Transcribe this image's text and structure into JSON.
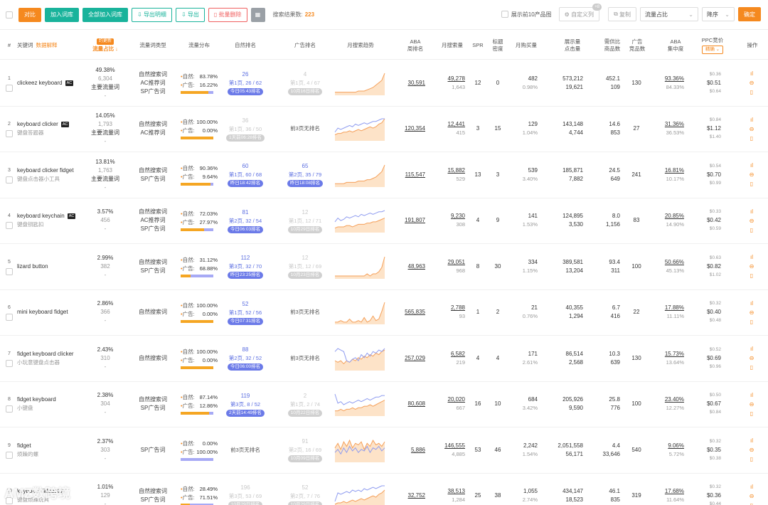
{
  "toolbar": {
    "compare": "对比",
    "add_to_lib": "加入词库",
    "add_all_to_lib": "全部加入词库",
    "export_detail": "导出明细",
    "export": "导出",
    "batch_delete": "批量删除",
    "result_label": "搜索结果数:",
    "result_count": "223",
    "show_top10": "展示前10产品图",
    "custom_columns": "自定义列",
    "custom_columns_badge": "+8",
    "copy": "复制",
    "sort_field": "流量占比",
    "sort_order": "降序",
    "confirm": "确定"
  },
  "header": {
    "idx": "#",
    "keyword": "关键词",
    "keyword_link": "数据解释",
    "share_tag": "约更新",
    "share": "流量占比",
    "type": "流量词类型",
    "flow": "流量分布",
    "natural": "自然排名",
    "ad": "广告排名",
    "trend": "月搜索趋势",
    "aba_1": "ABA",
    "aba_2": "周排名",
    "msv": "月搜索量",
    "spr": "SPR",
    "title_density_1": "标题",
    "title_density_2": "密度",
    "buy_1": "月购买量",
    "disp_1": "展示量",
    "disp_2": "点击量",
    "ratio_1": "需供比",
    "ratio_2": "商品数",
    "adprod_1": "广告",
    "adprod_2": "竞品数",
    "conc_1": "ABA",
    "conc_2": "集中度",
    "ppc": "PPC竞价",
    "ppc_select": "精确",
    "ops": "操作"
  },
  "rows": [
    {
      "idx": "1",
      "kw": "clickeez keyboard",
      "ac": "AC",
      "cn": "",
      "share": "49.38%",
      "share_num": "6,304",
      "share_tag": "主要流量词",
      "share_dash": "-",
      "types": [
        "自然搜索词",
        "AC推荐词",
        "SP广告词"
      ],
      "nat_pct": "83.78%",
      "ad_pct": "16.22%",
      "nat_frac": 0.8378,
      "nat": {
        "big": "26",
        "sub": "第1页, 26 / 62",
        "pill": "今日05:43排名",
        "faded": false
      },
      "ad": {
        "big": "4",
        "sub": "第1页, 4 / 67",
        "pill": "10月16日排名",
        "faded": true
      },
      "trend": [
        2,
        2,
        2,
        2,
        2,
        2,
        2,
        2,
        3,
        3,
        3,
        4,
        5,
        6,
        8,
        10,
        12,
        18
      ],
      "trend_b": [],
      "aba": "30,591",
      "msv": "49,278",
      "msv_sub": "1,643",
      "spr": "12",
      "tid": "0",
      "buy": "482",
      "buy_sub": "0.98%",
      "disp": "573,212",
      "disp_sub": "19,621",
      "ratio": "452.1",
      "ratio_sub": "109",
      "adp": "130",
      "conc": "93.36%",
      "conc_sub": "84.33%",
      "ppc": [
        "$0.36",
        "$0.51",
        "$0.64"
      ]
    },
    {
      "idx": "2",
      "kw": "keyboard clicker",
      "ac": "AC",
      "cn": "键盘答题器",
      "share": "14.05%",
      "share_num": "1,793",
      "share_tag": "主要流量词",
      "share_dash": "-",
      "types": [
        "自然搜索词",
        "AC推荐词"
      ],
      "nat_pct": "100.00%",
      "ad_pct": "0.00%",
      "nat_frac": 1.0,
      "nat": {
        "big": "36",
        "sub": "第1页, 36 / 50",
        "pill": "1天前06:28排名",
        "faded": true
      },
      "ad": {
        "big": "",
        "sub": "",
        "pill": "",
        "none": "前3页无排名"
      },
      "trend": [
        4,
        5,
        5,
        6,
        6,
        7,
        6,
        7,
        8,
        7,
        8,
        9,
        10,
        9,
        10,
        12,
        13,
        16
      ],
      "trend_b": [
        6,
        9,
        8,
        9,
        10,
        11,
        10,
        12,
        11,
        12,
        13,
        12,
        13,
        14,
        14,
        15,
        16,
        16
      ],
      "aba": "120,354",
      "msv": "12,441",
      "msv_sub": "415",
      "spr": "3",
      "tid": "15",
      "buy": "129",
      "buy_sub": "1.04%",
      "disp": "143,148",
      "disp_sub": "4,744",
      "ratio": "14.6",
      "ratio_sub": "853",
      "adp": "27",
      "conc": "31.36%",
      "conc_sub": "36.53%",
      "ppc": [
        "$0.84",
        "$1.12",
        "$1.40"
      ]
    },
    {
      "idx": "3",
      "kw": "keyboard clicker fidget",
      "ac": "",
      "cn": "键盘点击器小工具",
      "share": "13.81%",
      "share_num": "1,763",
      "share_tag": "主要流量词",
      "share_dash": "-",
      "types": [
        "自然搜索词",
        "SP广告词"
      ],
      "nat_pct": "90.36%",
      "ad_pct": "9.64%",
      "nat_frac": 0.9036,
      "nat": {
        "big": "60",
        "sub": "第1页, 60 / 68",
        "pill": "昨日18:42排名",
        "faded": false
      },
      "ad": {
        "big": "65",
        "sub": "第2页, 35 / 79",
        "pill": "昨日18:08排名",
        "faded": false
      },
      "trend": [
        2,
        2,
        2,
        2,
        3,
        3,
        3,
        3,
        4,
        4,
        4,
        5,
        5,
        6,
        7,
        9,
        11,
        16
      ],
      "trend_b": [],
      "aba": "115,547",
      "msv": "15,882",
      "msv_sub": "529",
      "spr": "13",
      "tid": "3",
      "buy": "539",
      "buy_sub": "3.40%",
      "disp": "185,871",
      "disp_sub": "7,882",
      "ratio": "24.5",
      "ratio_sub": "649",
      "adp": "241",
      "conc": "16.81%",
      "conc_sub": "10.17%",
      "ppc": [
        "$0.54",
        "$0.70",
        "$0.99"
      ]
    },
    {
      "idx": "4",
      "kw": "keyboard keychain",
      "ac": "AC",
      "cn": "键盘钥匙扣",
      "share": "3.57%",
      "share_num": "456",
      "share_tag": "",
      "share_dash": "-",
      "types": [
        "自然搜索词",
        "AC推荐词",
        "SP广告词"
      ],
      "nat_pct": "72.03%",
      "ad_pct": "27.97%",
      "nat_frac": 0.7203,
      "nat": {
        "big": "81",
        "sub": "第2页, 32 / 54",
        "pill": "今日06:03排名",
        "faded": false
      },
      "ad": {
        "big": "12",
        "sub": "第1页, 12 / 71",
        "pill": "10月29日排名",
        "faded": true
      },
      "trend": [
        3,
        4,
        4,
        4,
        5,
        5,
        4,
        5,
        6,
        6,
        6,
        7,
        7,
        8,
        8,
        9,
        10,
        11
      ],
      "trend_b": [
        8,
        11,
        9,
        10,
        12,
        11,
        12,
        13,
        12,
        14,
        13,
        14,
        15,
        14,
        15,
        16,
        16,
        17
      ],
      "aba": "191,807",
      "msv": "9,230",
      "msv_sub": "308",
      "spr": "4",
      "tid": "9",
      "buy": "141",
      "buy_sub": "1.53%",
      "disp": "124,895",
      "disp_sub": "3,530",
      "ratio": "8.0",
      "ratio_sub": "1,156",
      "adp": "83",
      "conc": "20.85%",
      "conc_sub": "14.90%",
      "ppc": [
        "$0.33",
        "$0.42",
        "$0.59"
      ]
    },
    {
      "idx": "5",
      "kw": "lizard button",
      "ac": "",
      "cn": "",
      "share": "2.99%",
      "share_num": "382",
      "share_tag": "",
      "share_dash": "-",
      "types": [
        "自然搜索词",
        "SP广告词"
      ],
      "nat_pct": "31.12%",
      "ad_pct": "68.88%",
      "nat_frac": 0.3112,
      "nat": {
        "big": "112",
        "sub": "第3页, 32 / 70",
        "pill": "昨日23:25排名",
        "faded": false
      },
      "ad": {
        "big": "12",
        "sub": "第1页, 12 / 69",
        "pill": "10月23日排名",
        "faded": true
      },
      "trend": [
        1,
        1,
        1,
        1,
        1,
        1,
        1,
        1,
        1,
        1,
        1,
        2,
        1,
        2,
        2,
        3,
        5,
        10
      ],
      "trend_b": [],
      "aba": "48,963",
      "msv": "29,051",
      "msv_sub": "968",
      "spr": "8",
      "tid": "30",
      "buy": "334",
      "buy_sub": "1.15%",
      "disp": "389,581",
      "disp_sub": "13,204",
      "ratio": "93.4",
      "ratio_sub": "311",
      "adp": "100",
      "conc": "50.66%",
      "conc_sub": "45.13%",
      "ppc": [
        "$0.63",
        "$0.82",
        "$1.02"
      ]
    },
    {
      "idx": "6",
      "kw": "mini keyboard fidget",
      "ac": "",
      "cn": "",
      "share": "2.86%",
      "share_num": "366",
      "share_tag": "",
      "share_dash": "-",
      "types": [
        "自然搜索词"
      ],
      "nat_pct": "100.00%",
      "ad_pct": "0.00%",
      "nat_frac": 1.0,
      "nat": {
        "big": "52",
        "sub": "第1页, 52 / 56",
        "pill": "今日07:31排名",
        "faded": false
      },
      "ad": {
        "big": "",
        "sub": "",
        "pill": "",
        "none": "前3页无排名"
      },
      "trend": [
        1,
        1,
        2,
        1,
        1,
        3,
        1,
        1,
        2,
        1,
        4,
        1,
        2,
        5,
        2,
        3,
        8,
        14
      ],
      "trend_b": [],
      "aba": "565,835",
      "msv": "2,788",
      "msv_sub": "93",
      "spr": "1",
      "tid": "2",
      "buy": "21",
      "buy_sub": "0.76%",
      "disp": "40,355",
      "disp_sub": "1,294",
      "ratio": "6.7",
      "ratio_sub": "416",
      "adp": "22",
      "conc": "17.88%",
      "conc_sub": "11.11%",
      "ppc": [
        "$0.32",
        "$0.40",
        "$0.48"
      ]
    },
    {
      "idx": "7",
      "kw": "fidget keyboard clicker",
      "ac": "",
      "cn": "小玩意键盘点击器",
      "share": "2.43%",
      "share_num": "310",
      "share_tag": "",
      "share_dash": "-",
      "types": [
        "自然搜索词"
      ],
      "nat_pct": "100.00%",
      "ad_pct": "0.00%",
      "nat_frac": 1.0,
      "nat": {
        "big": "88",
        "sub": "第2页, 32 / 52",
        "pill": "今日06:00排名",
        "faded": false
      },
      "ad": {
        "big": "",
        "sub": "",
        "pill": "",
        "none": "前3页无排名"
      },
      "trend": [
        6,
        5,
        6,
        4,
        6,
        5,
        7,
        6,
        8,
        7,
        9,
        8,
        10,
        9,
        11,
        10,
        12,
        13
      ],
      "trend_b": [
        12,
        14,
        13,
        12,
        6,
        5,
        7,
        8,
        6,
        10,
        8,
        11,
        9,
        12,
        11,
        13,
        12,
        14
      ],
      "aba": "257,029",
      "msv": "6,582",
      "msv_sub": "219",
      "spr": "4",
      "tid": "4",
      "buy": "171",
      "buy_sub": "2.61%",
      "disp": "86,514",
      "disp_sub": "2,568",
      "ratio": "10.3",
      "ratio_sub": "639",
      "adp": "130",
      "conc": "15.73%",
      "conc_sub": "13.64%",
      "ppc": [
        "$0.52",
        "$0.69",
        "$0.96"
      ]
    },
    {
      "idx": "8",
      "kw": "fidget keyboard",
      "ac": "",
      "cn": "小键盘",
      "share": "2.38%",
      "share_num": "304",
      "share_tag": "",
      "share_dash": "-",
      "types": [
        "自然搜索词",
        "SP广告词"
      ],
      "nat_pct": "87.14%",
      "ad_pct": "12.86%",
      "nat_frac": 0.8714,
      "nat": {
        "big": "119",
        "sub": "第3页, 8 / 52",
        "pill": "2天前14:49排名",
        "faded": false
      },
      "ad": {
        "big": "2",
        "sub": "第1页, 2 / 74",
        "pill": "10月22日排名",
        "faded": true
      },
      "trend": [
        3,
        3,
        4,
        3,
        4,
        4,
        5,
        4,
        5,
        5,
        6,
        6,
        7,
        6,
        7,
        8,
        9,
        10
      ],
      "trend_b": [
        14,
        8,
        9,
        7,
        8,
        9,
        8,
        9,
        10,
        9,
        10,
        11,
        10,
        11,
        12,
        12,
        13,
        13
      ],
      "aba": "80,608",
      "msv": "20,020",
      "msv_sub": "667",
      "spr": "16",
      "tid": "10",
      "buy": "684",
      "buy_sub": "3.42%",
      "disp": "205,926",
      "disp_sub": "9,590",
      "ratio": "25.8",
      "ratio_sub": "776",
      "adp": "100",
      "conc": "23.40%",
      "conc_sub": "12.27%",
      "ppc": [
        "$0.50",
        "$0.67",
        "$0.84"
      ]
    },
    {
      "idx": "9",
      "kw": "fidget",
      "ac": "",
      "cn": "烦躁的螺",
      "share": "2.37%",
      "share_num": "303",
      "share_tag": "",
      "share_dash": "-",
      "types": [
        "SP广告词"
      ],
      "nat_pct": "0.00%",
      "ad_pct": "100.00%",
      "nat_frac": 0.0,
      "nat": {
        "big": "",
        "sub": "",
        "pill": "",
        "none": "前3页无排名"
      },
      "ad": {
        "big": "91",
        "sub": "第2页, 16 / 69",
        "pill": "10月09日排名",
        "faded": true
      },
      "trend": [
        9,
        12,
        8,
        13,
        10,
        14,
        9,
        12,
        11,
        13,
        8,
        12,
        10,
        14,
        11,
        12,
        10,
        13
      ],
      "trend_b": [
        6,
        8,
        5,
        9,
        6,
        10,
        7,
        9,
        6,
        8,
        7,
        10,
        6,
        9,
        8,
        10,
        7,
        9
      ],
      "aba": "5,886",
      "msv": "146,555",
      "msv_sub": "4,885",
      "spr": "53",
      "tid": "46",
      "buy": "2,242",
      "buy_sub": "1.54%",
      "disp": "2,051,558",
      "disp_sub": "56,171",
      "ratio": "4.4",
      "ratio_sub": "33,646",
      "adp": "540",
      "conc": "9.06%",
      "conc_sub": "5.72%",
      "ppc": [
        "$0.32",
        "$0.35",
        "$0.38"
      ]
    },
    {
      "idx": "10",
      "kw": "keyboard fidget toy",
      "ac": "",
      "cn": "键盘烦躁玩具",
      "share": "1.01%",
      "share_num": "129",
      "share_tag": "",
      "share_dash": "-",
      "types": [
        "自然搜索词",
        "SP广告词"
      ],
      "nat_pct": "28.49%",
      "ad_pct": "71.51%",
      "nat_frac": 0.2849,
      "nat": {
        "big": "196",
        "sub": "第3页, 53 / 69",
        "pill": "10月29日排名",
        "faded": true
      },
      "ad": {
        "big": "52",
        "sub": "第2页, 7 / 76",
        "pill": "10月29日排名",
        "faded": true
      },
      "trend": [
        2,
        3,
        3,
        4,
        3,
        4,
        5,
        4,
        5,
        6,
        5,
        6,
        7,
        8,
        7,
        9,
        10,
        12
      ],
      "trend_b": [
        4,
        10,
        9,
        10,
        11,
        10,
        12,
        11,
        12,
        11,
        13,
        12,
        13,
        14,
        13,
        14,
        15,
        15
      ],
      "aba": "32,752",
      "msv": "38,513",
      "msv_sub": "1,284",
      "spr": "25",
      "tid": "38",
      "buy": "1,055",
      "buy_sub": "2.74%",
      "disp": "434,147",
      "disp_sub": "18,523",
      "ratio": "46.1",
      "ratio_sub": "835",
      "adp": "319",
      "conc": "17.68%",
      "conc_sub": "11.64%",
      "ppc": [
        "$0.32",
        "$0.36",
        "$0.44"
      ]
    }
  ],
  "labels": {
    "natural_prefix": "自然:",
    "ad_prefix": "广告:"
  },
  "watermark": "AMZ数跨境",
  "colors": {
    "accent": "#f5891f",
    "teal": "#19b39b",
    "rank_blue": "#5b6ee1",
    "bar_ad": "#a7aaf5",
    "bar_nat": "#f5a623"
  },
  "icons": [
    "chart-icon",
    "more-icon",
    "trash-icon"
  ]
}
